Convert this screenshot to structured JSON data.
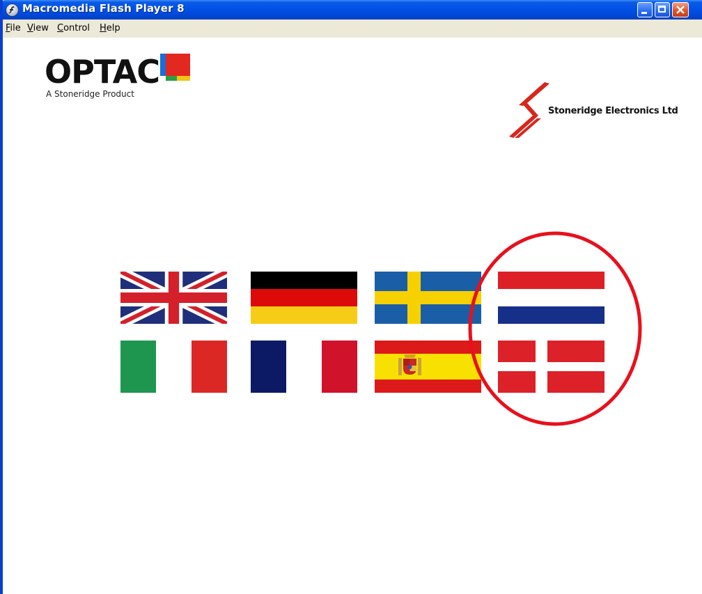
{
  "window": {
    "title": "Macromedia Flash Player 8",
    "icon": "flash-player-icon",
    "controls": [
      "minimize",
      "maximize",
      "close"
    ]
  },
  "menu": {
    "items": [
      {
        "label": "File",
        "accel": "F",
        "rest": "ile"
      },
      {
        "label": "View",
        "accel": "V",
        "rest": "iew"
      },
      {
        "label": "Control",
        "accel": "C",
        "rest": "ontrol"
      },
      {
        "label": "Help",
        "accel": "H",
        "rest": "elp"
      }
    ]
  },
  "logos": {
    "optac_name": "OPTAC",
    "optac_tagline": "A Stoneridge Product",
    "stoneridge_name": "Stoneridge Electronics Ltd"
  },
  "flags": [
    {
      "name": "uk-flag",
      "country": "United Kingdom"
    },
    {
      "name": "germany-flag",
      "country": "Germany"
    },
    {
      "name": "sweden-flag",
      "country": "Sweden"
    },
    {
      "name": "netherlands-flag",
      "country": "Netherlands"
    },
    {
      "name": "italy-flag",
      "country": "Italy"
    },
    {
      "name": "france-flag",
      "country": "France"
    },
    {
      "name": "spain-flag",
      "country": "Spain"
    },
    {
      "name": "denmark-flag",
      "country": "Denmark"
    }
  ],
  "colors": {
    "titlebar": "#0050e6",
    "menubar": "#ece9d8",
    "highlight": "#e8101c"
  }
}
